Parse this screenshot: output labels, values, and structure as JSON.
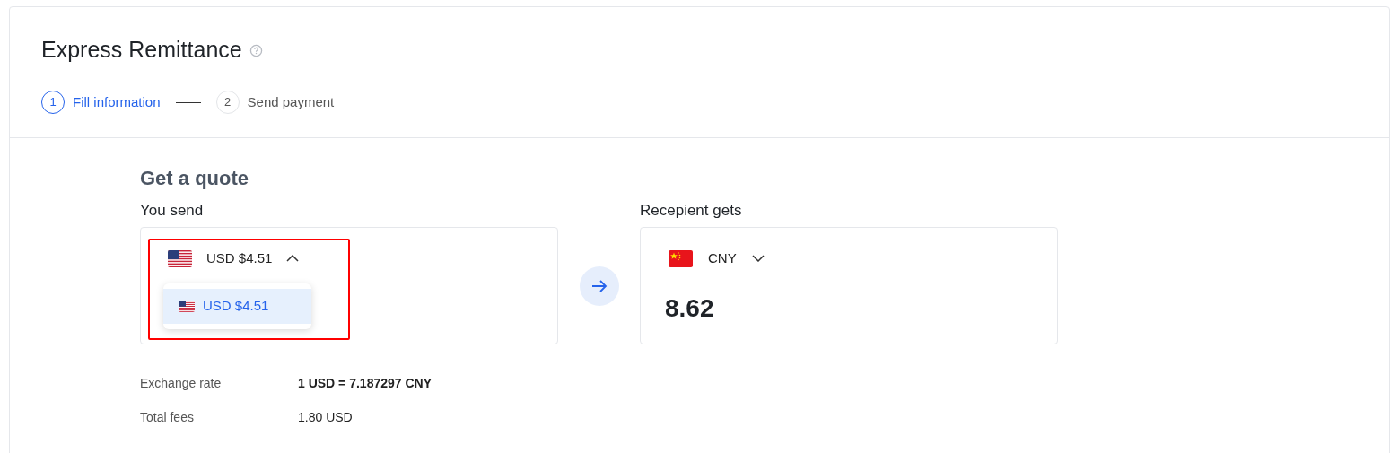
{
  "title": "Express Remittance",
  "steps": [
    {
      "number": "1",
      "label": "Fill information",
      "selected": true
    },
    {
      "number": "2",
      "label": "Send payment",
      "selected": false
    }
  ],
  "quote": {
    "heading": "Get a quote",
    "send": {
      "label": "You send",
      "currency": "USD $4.51",
      "kind": "us",
      "expanded": true,
      "highlighted": true,
      "options": [
        {
          "label": "USD $4.51",
          "kind": "us",
          "selected": true
        }
      ]
    },
    "receive": {
      "label": "Recepient gets",
      "currency": "CNY",
      "kind": "cn",
      "expanded": false,
      "highlighted": false,
      "amount": "8.62"
    }
  },
  "details": [
    {
      "label": "Exchange rate",
      "value": "1 USD = 7.187297 CNY",
      "bold": true
    },
    {
      "label": "Total fees",
      "value": "1.80 USD",
      "bold": false
    }
  ]
}
